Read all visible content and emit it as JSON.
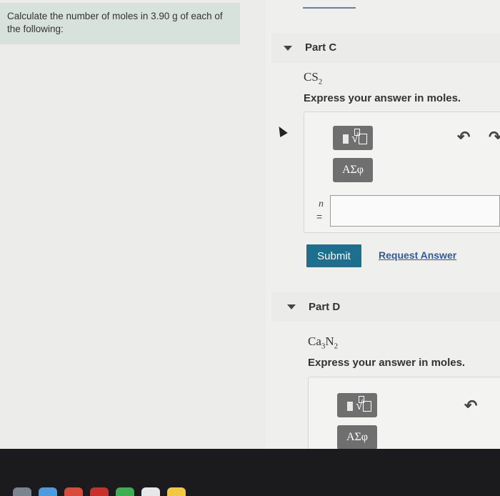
{
  "problem": {
    "text": "Calculate the number of moles in 3.90 g of each of the following:"
  },
  "part_c": {
    "title": "Part C",
    "formula_base": "CS",
    "formula_sub": "2",
    "instruction": "Express your answer in moles.",
    "symbols_label": "ΑΣφ",
    "variable": "n",
    "equals": "=",
    "answer_value": "",
    "submit_label": "Submit",
    "request_answer_label": "Request Answer"
  },
  "part_d": {
    "title": "Part D",
    "formula_a": "Ca",
    "formula_a_sub": "3",
    "formula_b": "N",
    "formula_b_sub": "2",
    "instruction": "Express your answer in moles.",
    "symbols_label": "ΑΣφ"
  },
  "icons": {
    "undo": "↶",
    "redo": "↷",
    "templates": "templates-icon",
    "cursor": "mouse-cursor"
  },
  "colors": {
    "submit": "#1d6f8d",
    "link": "#2c5aa8",
    "problem_bg": "#d8e2dd"
  }
}
